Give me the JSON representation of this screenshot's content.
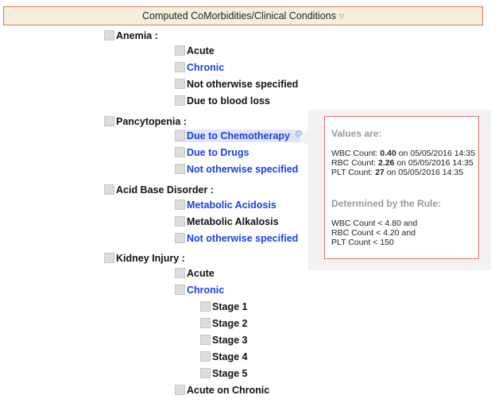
{
  "header": {
    "title": "Computed CoMorbidities/Clinical Conditions",
    "caret": "▽"
  },
  "groups": [
    {
      "label": "Anemia :",
      "items": [
        {
          "label": "Acute",
          "blue": false
        },
        {
          "label": "Chronic",
          "blue": true
        },
        {
          "label": "Not otherwise specified",
          "blue": false
        },
        {
          "label": "Due to blood loss",
          "blue": false
        }
      ]
    },
    {
      "label": "Pancytopenia :",
      "items": [
        {
          "label": "Due to Chemotherapy",
          "blue": true
        },
        {
          "label": "Due to Drugs",
          "blue": true
        },
        {
          "label": "Not otherwise specified",
          "blue": true
        }
      ]
    },
    {
      "label": "Acid Base Disorder :",
      "items": [
        {
          "label": "Metabolic Acidosis",
          "blue": true
        },
        {
          "label": "Metabolic Alkalosis",
          "blue": false
        },
        {
          "label": "Not otherwise specified",
          "blue": true
        }
      ]
    },
    {
      "label": "Kidney Injury :",
      "items": [
        {
          "label": "Acute",
          "blue": false
        },
        {
          "label": "Chronic",
          "blue": true,
          "sub": [
            "Stage 1",
            "Stage 2",
            "Stage 3",
            "Stage 4",
            "Stage 5"
          ]
        },
        {
          "label": "Acute on Chronic",
          "blue": false
        }
      ]
    }
  ],
  "popover": {
    "values_title": "Values are:",
    "values": [
      {
        "name": "WBC Count:",
        "value": "0.40",
        "suffix": "on 05/05/2016 14:35"
      },
      {
        "name": "RBC Count:",
        "value": "2.26",
        "suffix": "on 05/05/2016 14:35"
      },
      {
        "name": "PLT Count:",
        "value": "27",
        "suffix": "on 05/05/2016 14:35"
      }
    ],
    "rule_title": "Determined by the Rule:",
    "rules": [
      "WBC Count < 4.80 and",
      "RBC Count < 4.20 and",
      "PLT Count < 150"
    ]
  },
  "colors": {
    "link": "#1a3ee8",
    "border": "#e4706a",
    "header_bg": "#f3f1dc"
  }
}
